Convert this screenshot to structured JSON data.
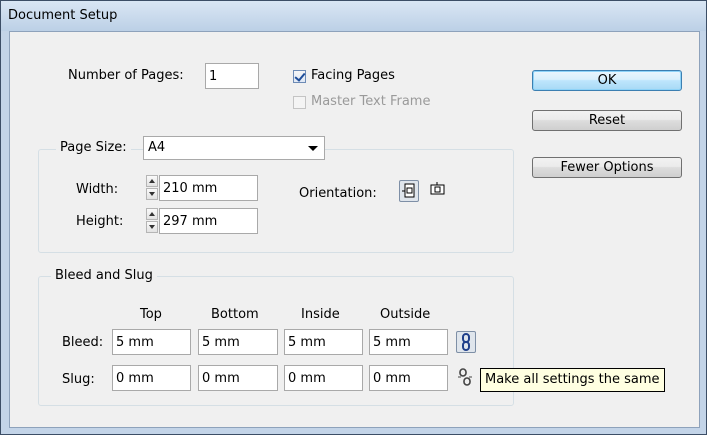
{
  "window": {
    "title": "Document Setup"
  },
  "pages": {
    "label": "Number of Pages:",
    "value": "1",
    "facing_label": "Facing Pages",
    "facing_checked": true,
    "master_label": "Master Text Frame",
    "master_checked": false,
    "master_enabled": false
  },
  "buttons": {
    "ok": "OK",
    "reset": "Reset",
    "fewer": "Fewer Options"
  },
  "page_size": {
    "group_label": "Page Size:",
    "selected": "A4",
    "width_label": "Width:",
    "width_value": "210 mm",
    "height_label": "Height:",
    "height_value": "297 mm",
    "orientation_label": "Orientation:",
    "orientation_selected": "portrait"
  },
  "bleed_slug": {
    "group_label": "Bleed and Slug",
    "columns": [
      "Top",
      "Bottom",
      "Inside",
      "Outside"
    ],
    "bleed_label": "Bleed:",
    "bleed": [
      "5 mm",
      "5 mm",
      "5 mm",
      "5 mm"
    ],
    "slug_label": "Slug:",
    "slug": [
      "0 mm",
      "0 mm",
      "0 mm",
      "0 mm"
    ],
    "bleed_link_active": true,
    "slug_link_active": false
  },
  "tooltip": "Make all settings the same",
  "colors": {
    "accent": "#3c7fb1",
    "tooltip_bg": "#ffffe1",
    "titlebar": "#c3d4e8"
  }
}
